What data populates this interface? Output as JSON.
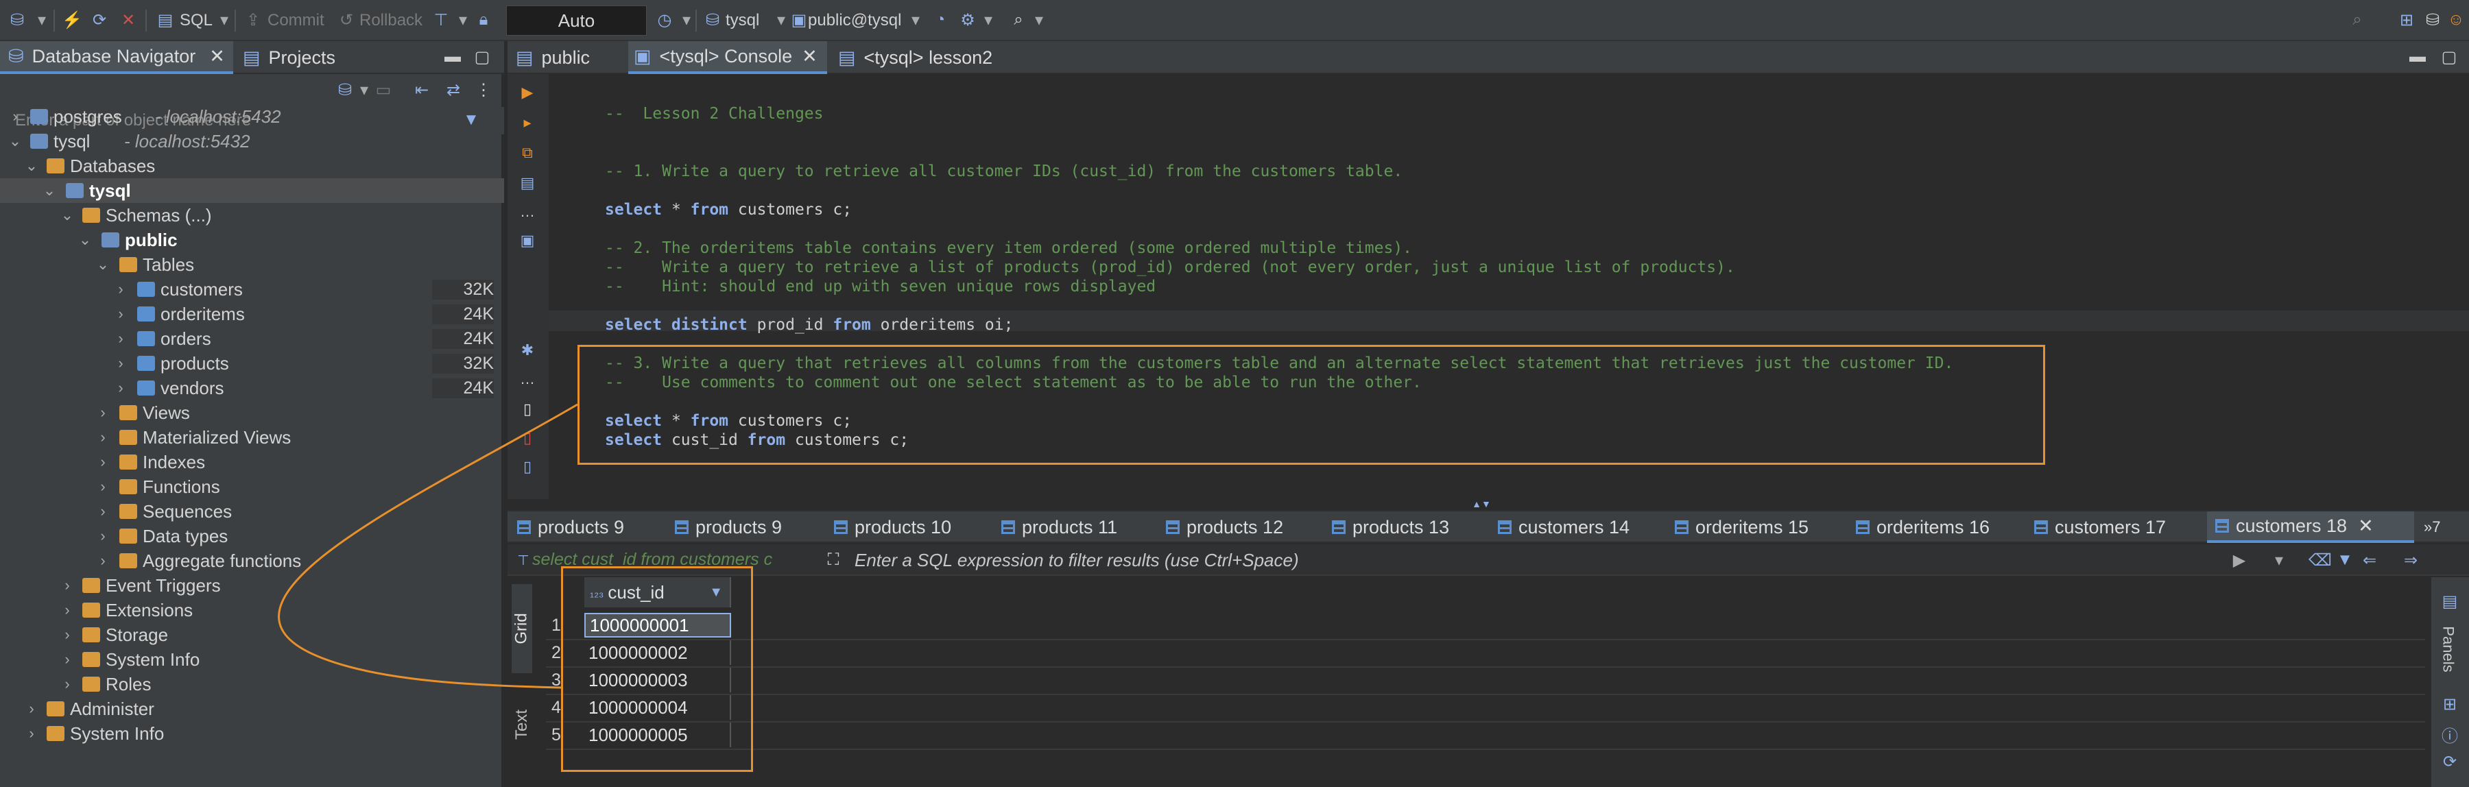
{
  "toolbar": {
    "sql": "SQL",
    "commit": "Commit",
    "rollback": "Rollback",
    "transaction_mode": "Auto",
    "datasource": "tysql",
    "schema": "public@tysql"
  },
  "navigator": {
    "tab_label": "Database Navigator",
    "projects_label": "Projects",
    "filter_placeholder": "Enter a part of object name here",
    "tree": [
      {
        "label": "postgres",
        "sub": "- localhost:5432"
      },
      {
        "label": "tysql",
        "sub": "- localhost:5432"
      },
      {
        "label": "Databases"
      },
      {
        "label": "tysql"
      },
      {
        "label": "Schemas (...)"
      },
      {
        "label": "public"
      },
      {
        "label": "Tables"
      },
      {
        "label": "customers",
        "size": "32K"
      },
      {
        "label": "orderitems",
        "size": "24K"
      },
      {
        "label": "orders",
        "size": "24K"
      },
      {
        "label": "products",
        "size": "32K"
      },
      {
        "label": "vendors",
        "size": "24K"
      },
      {
        "label": "Views"
      },
      {
        "label": "Materialized Views"
      },
      {
        "label": "Indexes"
      },
      {
        "label": "Functions"
      },
      {
        "label": "Sequences"
      },
      {
        "label": "Data types"
      },
      {
        "label": "Aggregate functions"
      },
      {
        "label": "Event Triggers"
      },
      {
        "label": "Extensions"
      },
      {
        "label": "Storage"
      },
      {
        "label": "System Info"
      },
      {
        "label": "Roles"
      },
      {
        "label": "Administer"
      },
      {
        "label": "System Info"
      }
    ]
  },
  "editor": {
    "tabs": [
      "public",
      "<tysql> Console",
      "<tysql> lesson2"
    ],
    "code": {
      "l1": "--  Lesson 2 Challenges",
      "l2": "-- 1. Write a query to retrieve all customer IDs (cust_id) from the customers table.",
      "l3": {
        "kw1": "select",
        "a": " * ",
        "kw2": "from",
        "b": " customers c;"
      },
      "l4": "-- 2. The orderitems table contains every item ordered (some ordered multiple times).",
      "l5": "--    Write a query to retrieve a list of products (prod_id) ordered (not every order, just a unique list of products).",
      "l6": "--    Hint: should end up with seven unique rows displayed",
      "l7": {
        "kw1": "select distinct",
        "a": " prod_id ",
        "kw2": "from",
        "b": " orderitems oi;"
      },
      "l8": "-- 3. Write a query that retrieves all columns from the customers table and an alternate select statement that retrieves just the customer ID.",
      "l9": "--    Use comments to comment out one select statement as to be able to run the other.",
      "l10": {
        "kw1": "select",
        "a": " * ",
        "kw2": "from",
        "b": " customers c;"
      },
      "l11": {
        "kw1": "select",
        "a": " cust_id ",
        "kw2": "from",
        "b": " customers c;"
      }
    }
  },
  "results": {
    "tabs": [
      "products 9",
      "products 9",
      "products 10",
      "products 11",
      "products 12",
      "products 13",
      "customers 14",
      "orderitems 15",
      "orderitems 16",
      "customers 17",
      "customers 18"
    ],
    "overflow": "»7",
    "query_text": "select cust_id from customers c",
    "filter_placeholder": "Enter a SQL expression to filter results (use Ctrl+Space)",
    "column": "cust_id",
    "rows": [
      "1000000001",
      "1000000002",
      "1000000003",
      "1000000004",
      "1000000005"
    ],
    "row_numbers": [
      "1",
      "2",
      "3",
      "4",
      "5"
    ],
    "side_labels": {
      "grid": "Grid",
      "text": "Text",
      "panels": "Panels"
    }
  },
  "colors": {
    "accent": "#e8912c",
    "selection": "#5a8fd0",
    "comment": "#629755",
    "keyword": "#8fb0e8"
  }
}
